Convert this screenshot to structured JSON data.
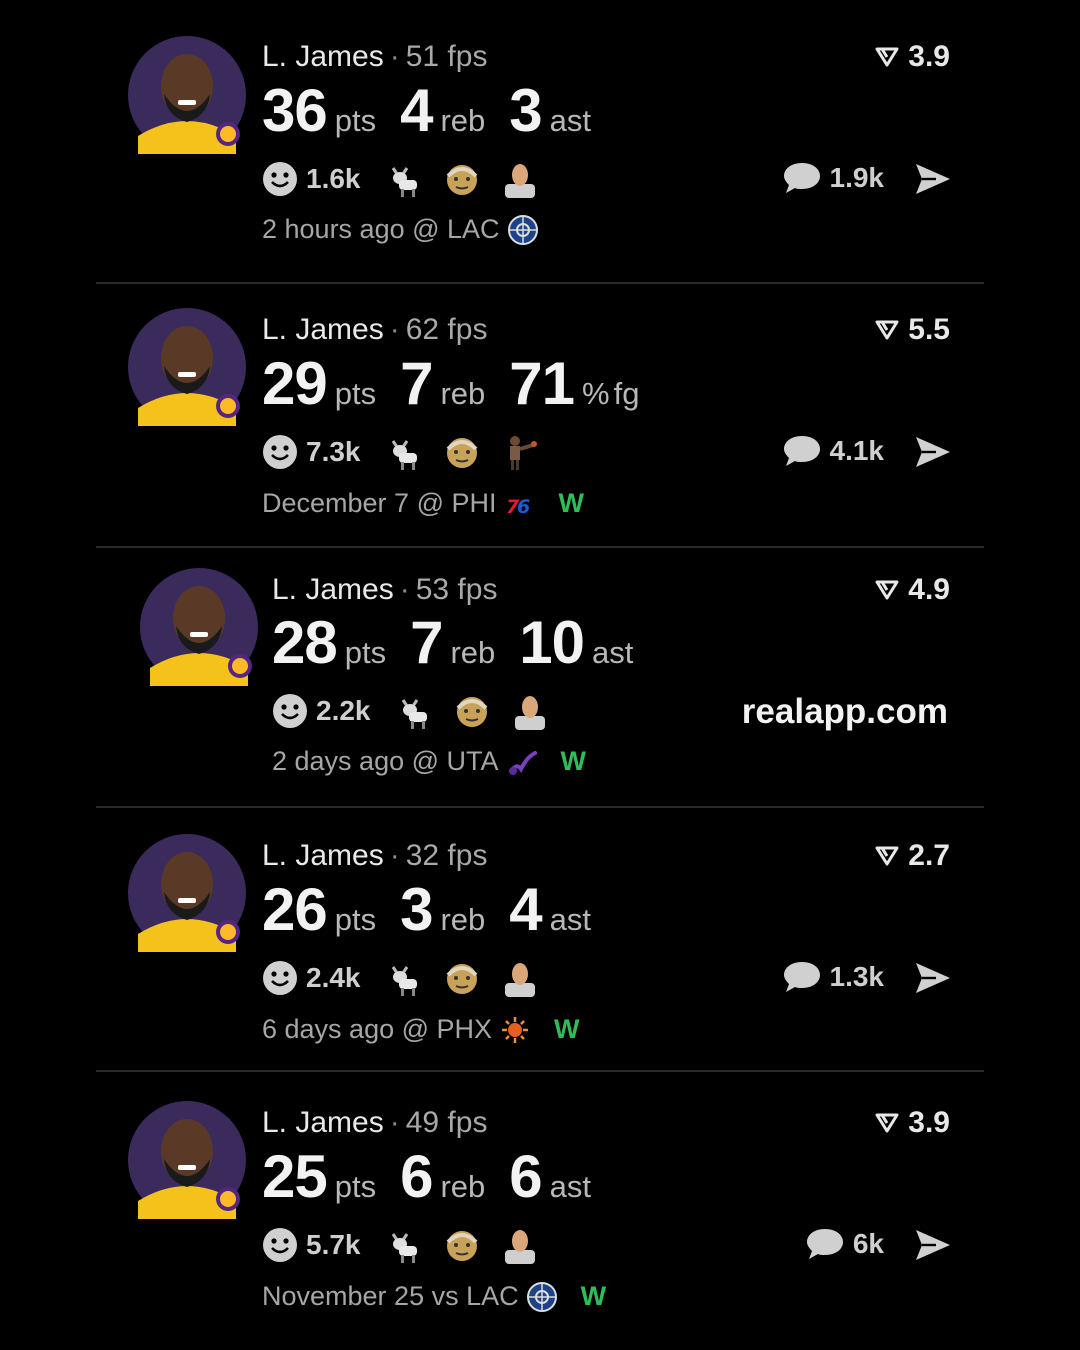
{
  "site": "realapp.com",
  "cards": [
    {
      "name": "L. James",
      "sep": "·",
      "fps": "51 fps",
      "score": "3.9",
      "stats": [
        {
          "n": "36",
          "u": "pts"
        },
        {
          "n": "4",
          "u": "reb"
        },
        {
          "n": "3",
          "u": "ast"
        }
      ],
      "reactions": "1.6k",
      "comments": "1.9k",
      "when": "2 hours ago @ LAC",
      "result": ""
    },
    {
      "name": "L. James",
      "sep": "·",
      "fps": "62 fps",
      "score": "5.5",
      "stats": [
        {
          "n": "29",
          "u": "pts"
        },
        {
          "n": "7",
          "u": "reb"
        },
        {
          "n": "71",
          "u": "%"
        },
        {
          "n": "",
          "u": "fg"
        }
      ],
      "reactions": "7.3k",
      "comments": "4.1k",
      "when": "December 7 @ PHI",
      "result": "W"
    },
    {
      "name": "L. James",
      "sep": "·",
      "fps": "53 fps",
      "score": "4.9",
      "stats": [
        {
          "n": "28",
          "u": "pts"
        },
        {
          "n": "7",
          "u": "reb"
        },
        {
          "n": "10",
          "u": "ast"
        }
      ],
      "reactions": "2.2k",
      "comments": "",
      "when": "2 days ago @ UTA",
      "result": "W"
    },
    {
      "name": "L. James",
      "sep": "·",
      "fps": "32 fps",
      "score": "2.7",
      "stats": [
        {
          "n": "26",
          "u": "pts"
        },
        {
          "n": "3",
          "u": "reb"
        },
        {
          "n": "4",
          "u": "ast"
        }
      ],
      "reactions": "2.4k",
      "comments": "1.3k",
      "when": "6 days ago @ PHX",
      "result": "W"
    },
    {
      "name": "L. James",
      "sep": "·",
      "fps": "49 fps",
      "score": "3.9",
      "stats": [
        {
          "n": "25",
          "u": "pts"
        },
        {
          "n": "6",
          "u": "reb"
        },
        {
          "n": "6",
          "u": "ast"
        }
      ],
      "reactions": "5.7k",
      "comments": "6k",
      "when": "November 25 vs LAC",
      "result": "W"
    }
  ]
}
